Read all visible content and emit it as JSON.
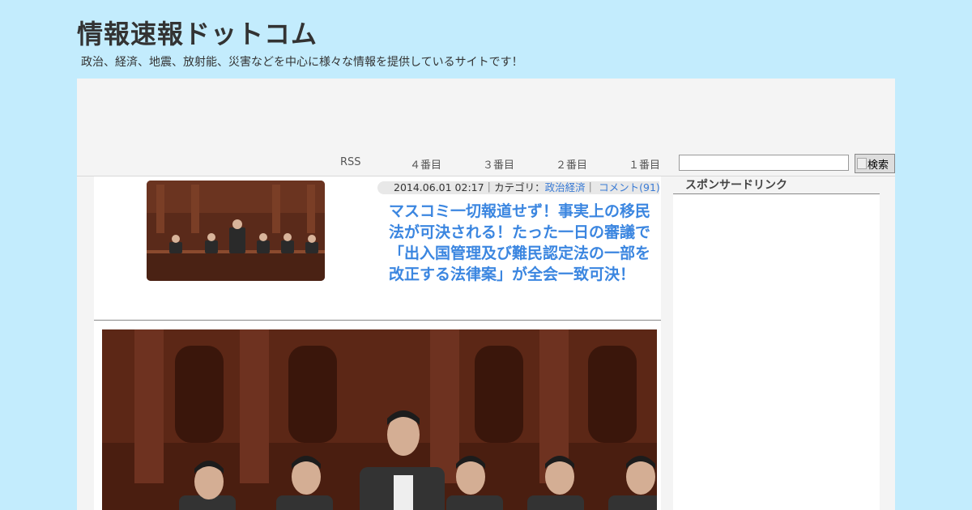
{
  "header": {
    "site_title": "情報速報ドットコム",
    "site_description": "政治、経済、地震、放射能、災害などを中心に様々な情報を提供しているサイトです！"
  },
  "nav": {
    "items": [
      "RSS",
      "４番目",
      "３番目",
      "２番目",
      "１番目"
    ]
  },
  "search": {
    "placeholder": "",
    "button_label": "検索"
  },
  "article": {
    "date": "2014.06.01 02:17",
    "category_label": "カテゴリ：",
    "category": "政治経済",
    "comments": "コメント(91)",
    "title": "マスコミ一切報道せず！事実上の移民法が可決される！たった一日の審議で「出入国管理及び難民認定法の一部を改正する法律案」が全会一致可決！"
  },
  "sidebar": {
    "heading": "スポンサードリンク"
  },
  "colors": {
    "background": "#c3ecfd",
    "link": "#3b86e0"
  }
}
